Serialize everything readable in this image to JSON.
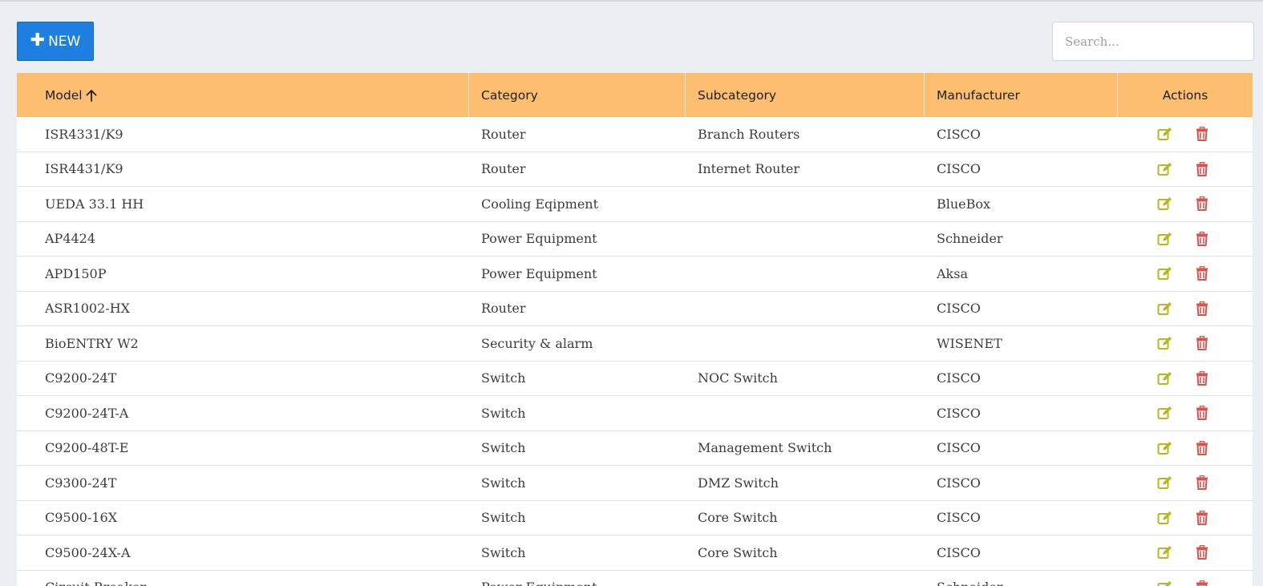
{
  "toolbar": {
    "new_label": "NEW",
    "search_placeholder": "Search..."
  },
  "table": {
    "headers": {
      "model": "Model",
      "category": "Category",
      "subcategory": "Subcategory",
      "manufacturer": "Manufacturer",
      "actions": "Actions"
    },
    "rows": [
      {
        "model": "ISR4331/K9",
        "category": "Router",
        "subcategory": "Branch Routers",
        "manufacturer": "CISCO"
      },
      {
        "model": "ISR4431/K9",
        "category": "Router",
        "subcategory": "Internet Router",
        "manufacturer": "CISCO"
      },
      {
        "model": "UEDA 33.1 HH",
        "category": "Cooling Eqipment",
        "subcategory": "",
        "manufacturer": "BlueBox"
      },
      {
        "model": "AP4424",
        "category": "Power Equipment",
        "subcategory": "",
        "manufacturer": "Schneider"
      },
      {
        "model": "APD150P",
        "category": "Power Equipment",
        "subcategory": "",
        "manufacturer": "Aksa"
      },
      {
        "model": "ASR1002-HX",
        "category": "Router",
        "subcategory": "",
        "manufacturer": "CISCO"
      },
      {
        "model": "BioENTRY W2",
        "category": "Security & alarm",
        "subcategory": "",
        "manufacturer": "WISENET"
      },
      {
        "model": "C9200-24T",
        "category": "Switch",
        "subcategory": "NOC Switch",
        "manufacturer": "CISCO"
      },
      {
        "model": "C9200-24T-A",
        "category": "Switch",
        "subcategory": "",
        "manufacturer": "CISCO"
      },
      {
        "model": "C9200-48T-E",
        "category": "Switch",
        "subcategory": "Management Switch",
        "manufacturer": "CISCO"
      },
      {
        "model": "C9300-24T",
        "category": "Switch",
        "subcategory": "DMZ Switch",
        "manufacturer": "CISCO"
      },
      {
        "model": "C9500-16X",
        "category": "Switch",
        "subcategory": "Core Switch",
        "manufacturer": "CISCO"
      },
      {
        "model": "C9500-24X-A",
        "category": "Switch",
        "subcategory": "Core Switch",
        "manufacturer": "CISCO"
      },
      {
        "model": "Circuit Breaker",
        "category": "Power Equipment",
        "subcategory": "",
        "manufacturer": "Schneider"
      }
    ]
  },
  "icons": {
    "new": "plus-icon",
    "sort": "arrow-up-icon",
    "edit": "edit-icon",
    "delete": "trash-icon"
  },
  "colors": {
    "primary": "#1e7fe0",
    "header_bg": "#fdbf6f",
    "edit": "#b5b81f",
    "delete": "#d9534f"
  }
}
